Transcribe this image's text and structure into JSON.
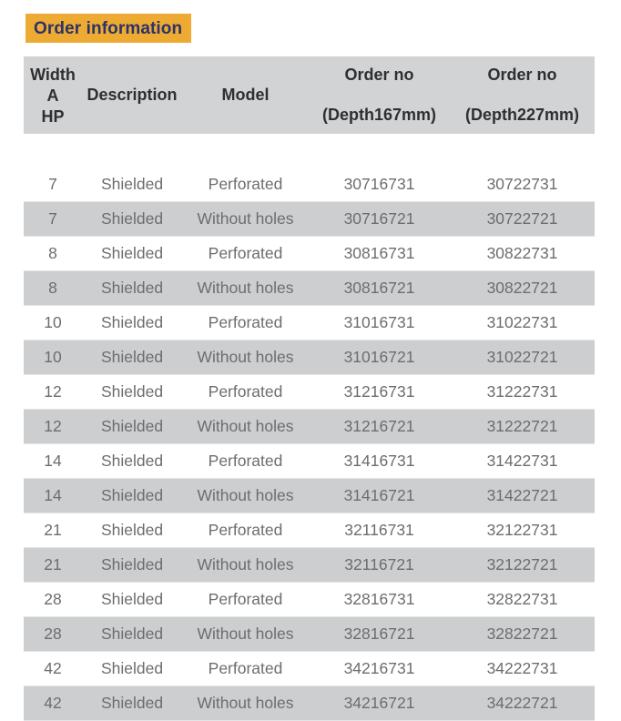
{
  "banner": {
    "title": "Order information",
    "background_color": "#eeab34",
    "text_color": "#2b3368"
  },
  "table": {
    "header_background": "#d2d3d5",
    "stripe_background": "#cdced0",
    "header_text_color": "#2f2f2f",
    "body_text_color": "#6d6d6d",
    "columns": [
      {
        "id": "width",
        "lines": [
          "Width",
          "A",
          "HP"
        ]
      },
      {
        "id": "description",
        "lines": [
          "Description"
        ]
      },
      {
        "id": "model",
        "lines": [
          "Model"
        ]
      },
      {
        "id": "order_no_167",
        "lines": [
          "Order no",
          "(Depth167mm)"
        ]
      },
      {
        "id": "order_no_227",
        "lines": [
          "Order no",
          "(Depth227mm)"
        ]
      }
    ],
    "rows": [
      {
        "width": "7",
        "description": "Shielded",
        "model": "Perforated",
        "order_no_167": "30716731",
        "order_no_227": "30722731",
        "striped": false
      },
      {
        "width": "7",
        "description": "Shielded",
        "model": "Without holes",
        "order_no_167": "30716721",
        "order_no_227": "30722721",
        "striped": true
      },
      {
        "width": "8",
        "description": "Shielded",
        "model": "Perforated",
        "order_no_167": "30816731",
        "order_no_227": "30822731",
        "striped": false
      },
      {
        "width": "8",
        "description": "Shielded",
        "model": "Without holes",
        "order_no_167": "30816721",
        "order_no_227": "30822721",
        "striped": true
      },
      {
        "width": "10",
        "description": "Shielded",
        "model": "Perforated",
        "order_no_167": "31016731",
        "order_no_227": "31022731",
        "striped": false
      },
      {
        "width": "10",
        "description": "Shielded",
        "model": "Without holes",
        "order_no_167": "31016721",
        "order_no_227": "31022721",
        "striped": true
      },
      {
        "width": "12",
        "description": "Shielded",
        "model": "Perforated",
        "order_no_167": "31216731",
        "order_no_227": "31222731",
        "striped": false
      },
      {
        "width": "12",
        "description": "Shielded",
        "model": "Without holes",
        "order_no_167": "31216721",
        "order_no_227": "31222721",
        "striped": true
      },
      {
        "width": "14",
        "description": "Shielded",
        "model": "Perforated",
        "order_no_167": "31416731",
        "order_no_227": "31422731",
        "striped": false
      },
      {
        "width": "14",
        "description": "Shielded",
        "model": "Without holes",
        "order_no_167": "31416721",
        "order_no_227": "31422721",
        "striped": true
      },
      {
        "width": "21",
        "description": "Shielded",
        "model": "Perforated",
        "order_no_167": "32116731",
        "order_no_227": "32122731",
        "striped": false
      },
      {
        "width": "21",
        "description": "Shielded",
        "model": "Without holes",
        "order_no_167": "32116721",
        "order_no_227": "32122721",
        "striped": true
      },
      {
        "width": "28",
        "description": "Shielded",
        "model": "Perforated",
        "order_no_167": "32816731",
        "order_no_227": "32822731",
        "striped": false
      },
      {
        "width": "28",
        "description": "Shielded",
        "model": "Without holes",
        "order_no_167": "32816721",
        "order_no_227": "32822721",
        "striped": true
      },
      {
        "width": "42",
        "description": "Shielded",
        "model": "Perforated",
        "order_no_167": "34216731",
        "order_no_227": "34222731",
        "striped": false
      },
      {
        "width": "42",
        "description": "Shielded",
        "model": "Without holes",
        "order_no_167": "34216721",
        "order_no_227": "34222721",
        "striped": true
      }
    ]
  }
}
